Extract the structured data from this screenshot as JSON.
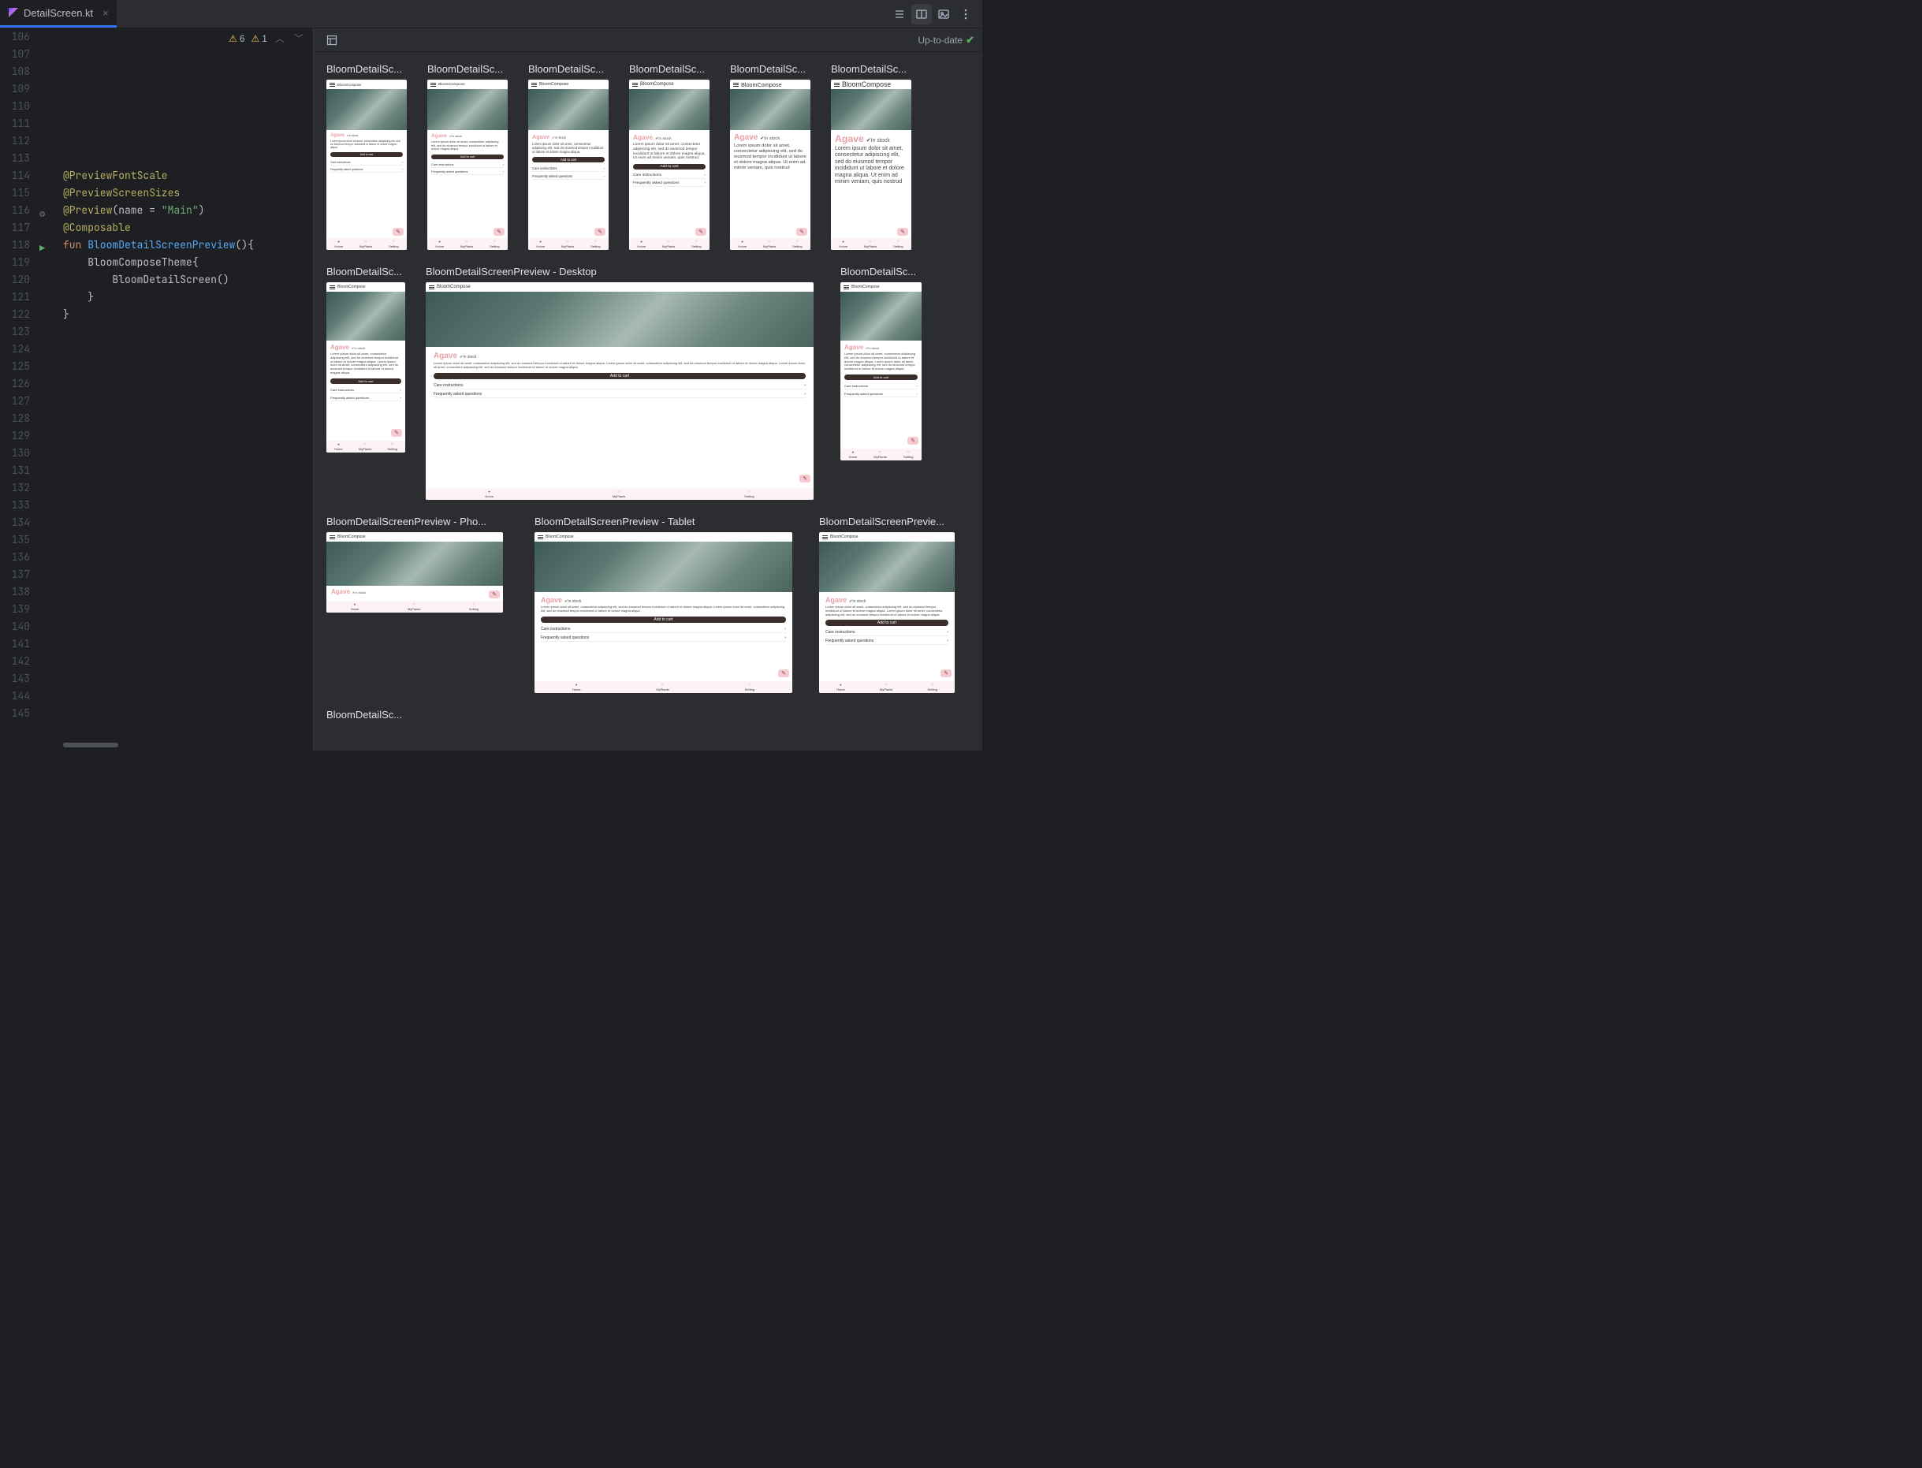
{
  "tab": {
    "filename": "DetailScreen.kt"
  },
  "toolbar": {
    "list_view": "list-view",
    "grid_view": "grid-view",
    "image_view": "image-view",
    "more": "more"
  },
  "inspections": {
    "warn_weak_count": "6",
    "warn_count": "1"
  },
  "editor": {
    "line_start": 106,
    "line_end": 145,
    "gutter_marks": {
      "116": "gear",
      "118": "run"
    },
    "code": {
      "l114": "@PreviewFontScale",
      "l115": "@PreviewScreenSizes",
      "l116_a": "@Preview",
      "l116_b": "(name = ",
      "l116_c": "\"Main\"",
      "l116_d": ")",
      "l117": "@Composable",
      "l118_a": "fun ",
      "l118_b": "BloomDetailScreenPreview",
      "l118_c": "(){",
      "l119_a": "    BloomComposeTheme",
      "l119_b": "{",
      "l120_a": "        BloomDetailScreen",
      "l120_b": "()",
      "l121": "    }",
      "l122": "}"
    }
  },
  "preview": {
    "status": "Up-to-date",
    "labels": {
      "truncated": "BloomDetailSc...",
      "desktop": "BloomDetailScreenPreview - Desktop",
      "phone": "BloomDetailScreenPreview - Pho...",
      "tablet": "BloomDetailScreenPreview - Tablet",
      "last": "BloomDetailScreenPrevie..."
    }
  },
  "mock": {
    "app_title": "BloomCompose",
    "plant_title": "Agave",
    "in_stock": "In stock",
    "lorem_short": "Lorem ipsum dolor sit amet, consectetur adipiscing elit, sed do eiusmod tempor incididunt ut labore et dolore magna aliqua.",
    "lorem_long": "Lorem ipsum dolor sit amet, consectetur adipiscing elit, sed do eiusmod tempor incididunt ut labore et dolore magna aliqua. Ut enim ad minim veniam, quis nostrud",
    "add_to_cart": "Add to cart",
    "care": "Care instructions",
    "faq": "Frequently asked questions",
    "nav": {
      "home": "Home",
      "myplants": "MyPlants",
      "setting": "Setting"
    }
  }
}
